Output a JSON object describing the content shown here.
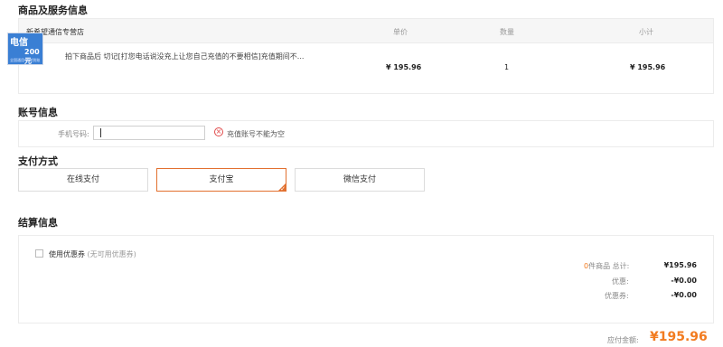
{
  "product_section": {
    "title": "商品及服务信息",
    "store_name": "新希望通信专营店",
    "col_unit_price": "单价",
    "col_quantity": "数量",
    "col_subtotal": "小计",
    "item": {
      "thumb_text_top": "电信",
      "thumb_text_amount": "200元",
      "thumb_text_small": "全国通用 即时到账",
      "name": "拍下商品后 切记[打您电话说没充上让您自己充值的不要相信]充值期间不...",
      "unit_price": "¥ 195.96",
      "quantity": "1",
      "subtotal": "¥ 195.96"
    }
  },
  "account_section": {
    "title": "账号信息",
    "phone_label": "手机号码:",
    "phone_value": "",
    "error_text": "充值账号不能为空"
  },
  "payment_section": {
    "title": "支付方式",
    "options": [
      "在线支付",
      "支付宝",
      "微信支付"
    ],
    "selected": "支付宝"
  },
  "settlement_section": {
    "title": "结算信息",
    "coupon_label": "使用优惠券",
    "coupon_note": "(无可用优惠券)",
    "items_count": "0",
    "items_label": "件商品 总计:",
    "items_total": "¥195.96",
    "discount_label": "优惠:",
    "discount_value": "-¥0.00",
    "coupon_discount_label": "优惠券:",
    "coupon_discount_value": "-¥0.00",
    "payable_label": "应付金额:",
    "payable_value": "¥195.96"
  },
  "colors": {
    "accent": "#f27b1f",
    "error": "#e04a4a",
    "brand_thumb": "#3a7fd4"
  }
}
